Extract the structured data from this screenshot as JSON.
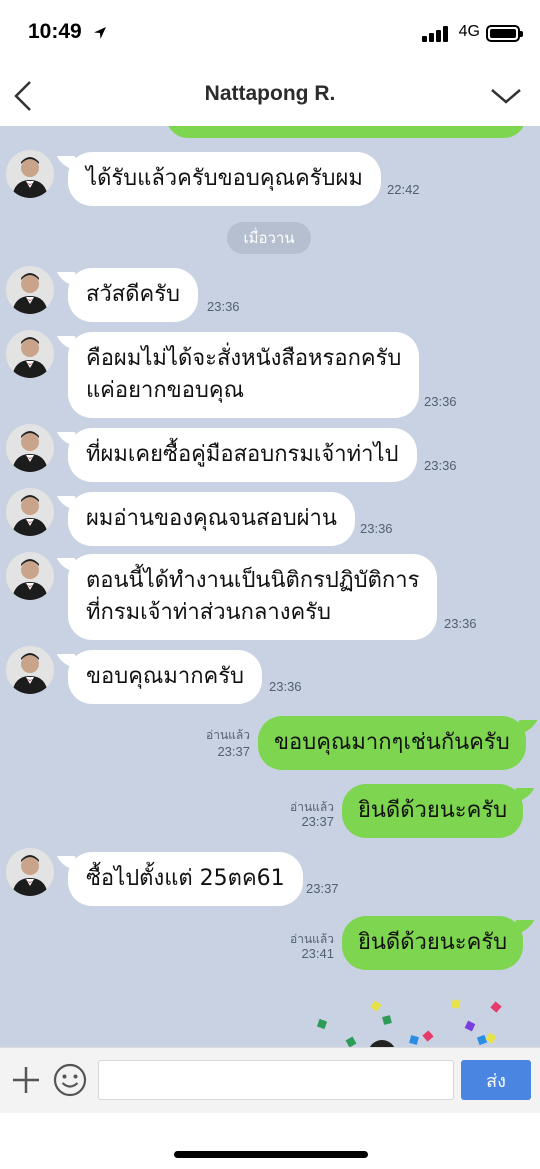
{
  "status_bar": {
    "time": "10:49",
    "network": "4G",
    "location_icon": "location-arrow-icon",
    "signal_icon": "signal-bars-icon",
    "battery_icon": "battery-icon"
  },
  "header": {
    "title": "Nattapong R.",
    "back_icon": "chevron-left-icon",
    "menu_icon": "chevron-down-icon"
  },
  "date_separator": "เมื่อวาน",
  "messages": [
    {
      "dir": "in",
      "text": "ได้รับแล้วครับขอบคุณครับผม",
      "time": "22:42"
    },
    {
      "dir": "in",
      "text": "สวัสดีครับ",
      "time": "23:36"
    },
    {
      "dir": "in",
      "lines": [
        "คือผมไม่ได้จะสั่งหนังสือหรอกครับ",
        "แค่อยากขอบคุณ"
      ],
      "time": "23:36"
    },
    {
      "dir": "in",
      "text": "ที่ผมเคยซื้อคู่มือสอบกรมเจ้าท่าไป",
      "time": "23:36"
    },
    {
      "dir": "in",
      "text": "ผมอ่านของคุณจนสอบผ่าน",
      "time": "23:36"
    },
    {
      "dir": "in",
      "lines": [
        "ตอนนี้ได้ทำงานเป็นนิติกรปฏิบัติการ",
        "ที่กรมเจ้าท่าส่วนกลางครับ"
      ],
      "time": "23:36"
    },
    {
      "dir": "in",
      "text": "ขอบคุณมากครับ",
      "time": "23:36"
    },
    {
      "dir": "out",
      "text": "ขอบคุณมากๆเช่นกันครับ",
      "time": "23:37",
      "read": "อ่านแล้ว"
    },
    {
      "dir": "out",
      "text": "ยินดีด้วยนะครับ",
      "time": "23:37",
      "read": "อ่านแล้ว"
    },
    {
      "dir": "in",
      "text": "ซื้อไปตั้งแต่ 25ตค61",
      "time": "23:37"
    },
    {
      "dir": "out",
      "text": "ยินดีด้วยนะครับ",
      "time": "23:41",
      "read": "อ่านแล้ว"
    }
  ],
  "input": {
    "placeholder": "",
    "value": "",
    "send_label": "ส่ง",
    "plus_icon": "plus-icon",
    "emoji_icon": "smiley-icon"
  },
  "colors": {
    "chat_bg": "#c8d2e3",
    "outgoing_bubble": "#7ed54f",
    "incoming_bubble": "#ffffff",
    "send_button": "#4a85e2"
  }
}
